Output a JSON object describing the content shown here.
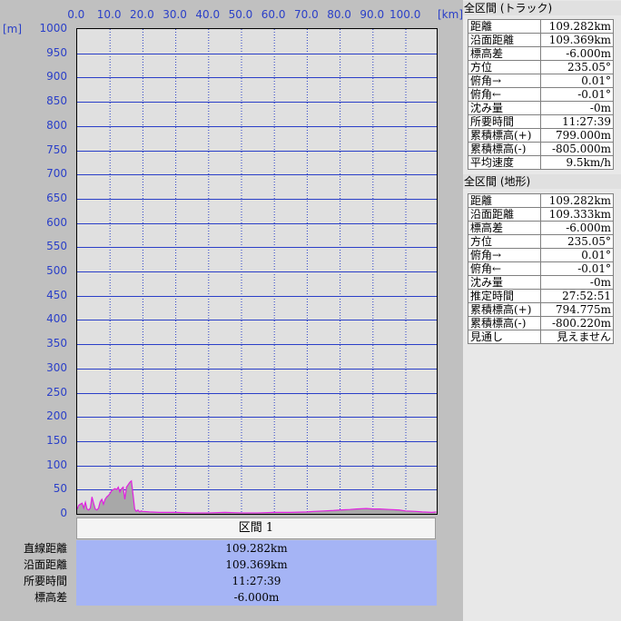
{
  "chart": {
    "x_unit": "[km]",
    "y_unit": "[m]",
    "x_ticks": [
      "0.0",
      "10.0",
      "20.0",
      "30.0",
      "40.0",
      "50.0",
      "60.0",
      "70.0",
      "80.0",
      "90.0",
      "100.0"
    ],
    "y_ticks": [
      "1000",
      "950",
      "900",
      "850",
      "800",
      "750",
      "700",
      "650",
      "600",
      "550",
      "500",
      "450",
      "400",
      "350",
      "300",
      "250",
      "200",
      "150",
      "100",
      "50",
      "0"
    ],
    "colors": {
      "grid": "#2a3fc8",
      "track": "#e020e0",
      "fill": "#a8a8a8",
      "plot_bg": "#e0e0e0"
    }
  },
  "chart_data": {
    "type": "area",
    "title": "",
    "xlabel": "[km]",
    "ylabel": "[m]",
    "xlim": [
      0,
      109.282
    ],
    "ylim": [
      0,
      1000
    ],
    "grid": true,
    "series": [
      {
        "x": [
          0,
          0.5,
          1,
          1.5,
          2,
          2.5,
          3,
          3.5,
          4,
          4.5,
          5,
          5.5,
          6,
          6.5,
          7,
          7.5,
          8,
          8.5,
          9,
          9.5,
          10,
          10.5,
          11,
          11.5,
          12,
          12.5,
          13,
          13.5,
          14,
          14.5,
          15,
          15.5,
          16,
          16.5,
          17,
          17.5,
          18,
          18.5,
          19,
          19.5,
          20,
          22,
          25,
          30,
          35,
          40,
          45,
          50,
          55,
          60,
          65,
          70,
          72,
          75,
          78,
          80,
          83,
          85,
          88,
          90,
          92,
          95,
          98,
          100,
          103,
          105,
          108,
          109.28
        ],
        "y": [
          10,
          18,
          20,
          22,
          12,
          24,
          10,
          8,
          12,
          35,
          22,
          10,
          8,
          12,
          25,
          30,
          20,
          30,
          35,
          38,
          42,
          48,
          50,
          52,
          50,
          55,
          45,
          52,
          55,
          30,
          55,
          60,
          65,
          68,
          40,
          10,
          5,
          8,
          4,
          6,
          5,
          4,
          3,
          3,
          2,
          2,
          3,
          2,
          2,
          3,
          3,
          4,
          5,
          6,
          7,
          8,
          9,
          10,
          11,
          10,
          10,
          9,
          8,
          6,
          5,
          4,
          3,
          4
        ]
      }
    ]
  },
  "section": {
    "header": "区間 1",
    "rows": [
      {
        "label": "直線距離",
        "value": "109.282km"
      },
      {
        "label": "沿面距離",
        "value": "109.369km"
      },
      {
        "label": "所要時間",
        "value": "11:27:39"
      },
      {
        "label": "標高差",
        "value": "-6.000m"
      }
    ]
  },
  "track_panel": {
    "title": "全区間 (トラック)",
    "rows": [
      {
        "label": "距離",
        "value": "109.282km"
      },
      {
        "label": "沿面距離",
        "value": "109.369km"
      },
      {
        "label": "標高差",
        "value": "-6.000m"
      },
      {
        "label": "方位",
        "value": "235.05°"
      },
      {
        "label": "俯角→",
        "value": "0.01°"
      },
      {
        "label": "俯角←",
        "value": "-0.01°"
      },
      {
        "label": "沈み量",
        "value": "-0m"
      },
      {
        "label": "所要時間",
        "value": "11:27:39"
      },
      {
        "label": "累積標高(+)",
        "value": "799.000m"
      },
      {
        "label": "累積標高(-)",
        "value": "-805.000m"
      },
      {
        "label": "平均速度",
        "value": "9.5km/h"
      }
    ]
  },
  "terrain_panel": {
    "title": "全区間 (地形)",
    "rows": [
      {
        "label": "距離",
        "value": "109.282km"
      },
      {
        "label": "沿面距離",
        "value": "109.333km"
      },
      {
        "label": "標高差",
        "value": "-6.000m"
      },
      {
        "label": "方位",
        "value": "235.05°"
      },
      {
        "label": "俯角→",
        "value": "0.01°"
      },
      {
        "label": "俯角←",
        "value": "-0.01°"
      },
      {
        "label": "沈み量",
        "value": "-0m"
      },
      {
        "label": "推定時間",
        "value": "27:52:51"
      },
      {
        "label": "累積標高(+)",
        "value": "794.775m"
      },
      {
        "label": "累積標高(-)",
        "value": "-800.220m"
      },
      {
        "label": "見通し",
        "value": "見えません"
      }
    ]
  }
}
